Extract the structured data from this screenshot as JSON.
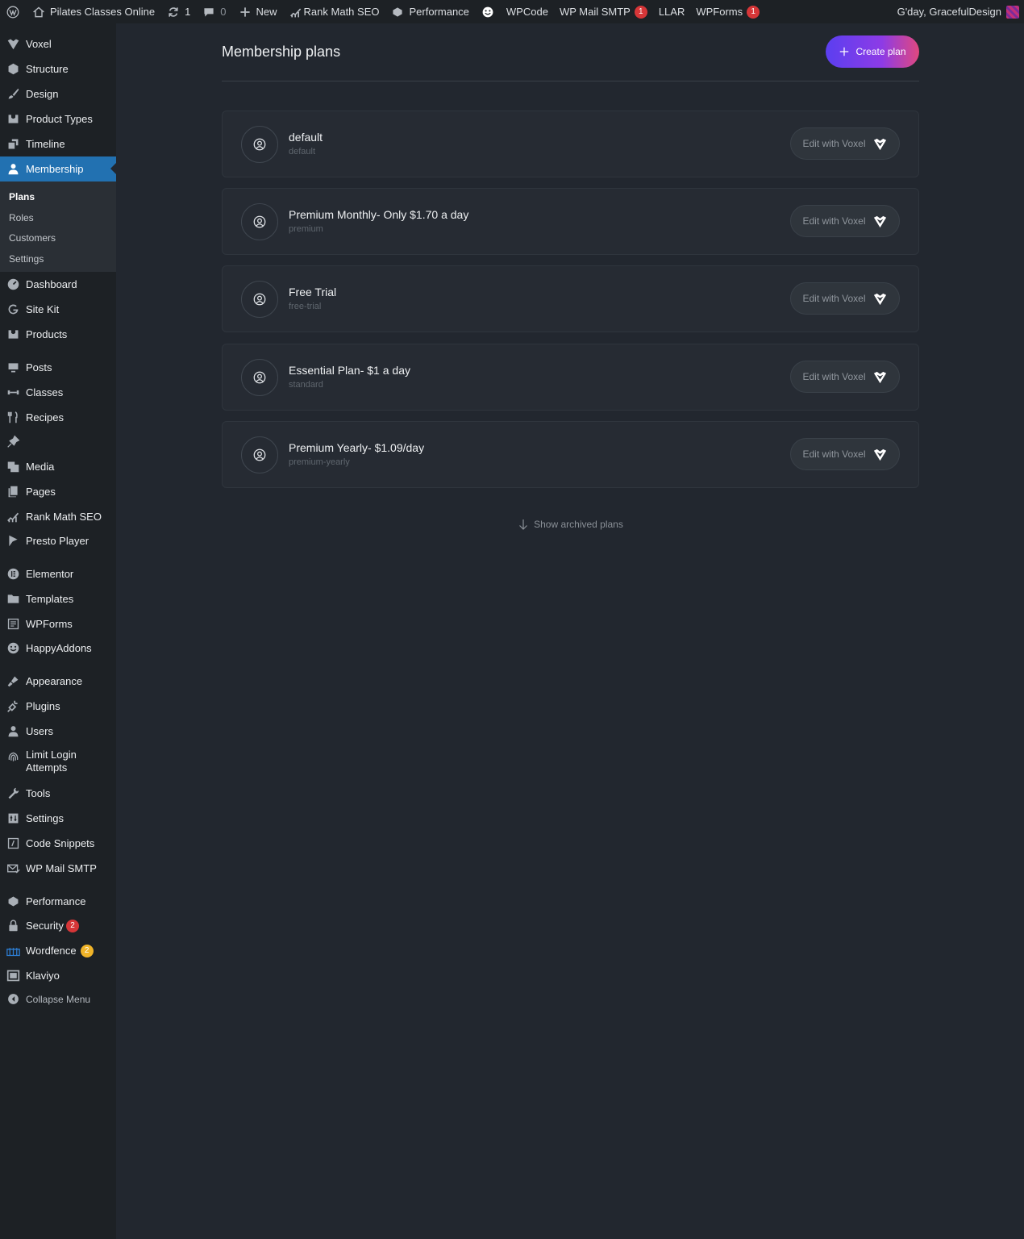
{
  "adminbar": {
    "site_name": "Pilates Classes Online",
    "updates_count": "1",
    "comments_count": "0",
    "new_label": "New",
    "rankmath_label": "Rank Math SEO",
    "performance_label": "Performance",
    "wpcode_label": "WPCode",
    "wpmail_label": "WP Mail SMTP",
    "wpmail_badge": "1",
    "llar_label": "LLAR",
    "wpforms_label": "WPForms",
    "wpforms_badge": "1",
    "greeting": "G'day, GracefulDesign"
  },
  "sidebar": {
    "voxel": "Voxel",
    "structure": "Structure",
    "design": "Design",
    "product_types": "Product Types",
    "timeline": "Timeline",
    "membership": "Membership",
    "submenu": [
      "Plans",
      "Roles",
      "Customers",
      "Settings"
    ],
    "dashboard": "Dashboard",
    "site_kit": "Site Kit",
    "products": "Products",
    "posts": "Posts",
    "classes": "Classes",
    "recipes": "Recipes",
    "media": "Media",
    "pages": "Pages",
    "rank_math": "Rank Math SEO",
    "presto": "Presto Player",
    "elementor": "Elementor",
    "templates": "Templates",
    "wpforms": "WPForms",
    "happyaddons": "HappyAddons",
    "appearance": "Appearance",
    "plugins": "Plugins",
    "users": "Users",
    "limit_login_1": "Limit Login",
    "limit_login_2": "Attempts",
    "tools": "Tools",
    "settings": "Settings",
    "code_snippets": "Code Snippets",
    "wp_mail_smtp": "WP Mail SMTP",
    "performance": "Performance",
    "security": "Security",
    "security_badge": "2",
    "wordfence": "Wordfence",
    "wordfence_badge": "2",
    "klaviyo": "Klaviyo",
    "collapse": "Collapse Menu"
  },
  "main": {
    "title": "Membership plans",
    "create_label": "Create plan",
    "edit_label": "Edit with Voxel",
    "plans": [
      {
        "name": "default",
        "key": "default"
      },
      {
        "name": "Premium Monthly- Only $1.70 a day",
        "key": "premium"
      },
      {
        "name": "Free Trial",
        "key": "free-trial"
      },
      {
        "name": "Essential Plan- $1 a day",
        "key": "standard"
      },
      {
        "name": "Premium Yearly- $1.09/day",
        "key": "premium-yearly"
      }
    ],
    "show_archived": "Show archived plans"
  }
}
